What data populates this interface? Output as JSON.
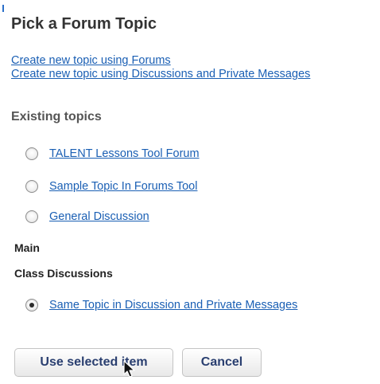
{
  "page": {
    "title": "Pick a Forum Topic"
  },
  "create_links": [
    "Create new topic using Forums",
    "Create new topic using Discussions and Private Messages"
  ],
  "existing": {
    "heading": "Existing topics",
    "topics": [
      {
        "label": "TALENT Lessons Tool Forum",
        "selected": false
      },
      {
        "label": "Sample Topic In Forums Tool",
        "selected": false
      },
      {
        "label": "General Discussion",
        "selected": false
      }
    ]
  },
  "groups": {
    "main": "Main",
    "class_discussions": "Class Discussions",
    "class_topic": {
      "label": "Same Topic in Discussion and Private Messages",
      "selected": true
    }
  },
  "buttons": {
    "use_selected": "Use selected item",
    "cancel": "Cancel"
  },
  "colors": {
    "link": "#1a5fb4",
    "button_text": "#2a3f70"
  }
}
